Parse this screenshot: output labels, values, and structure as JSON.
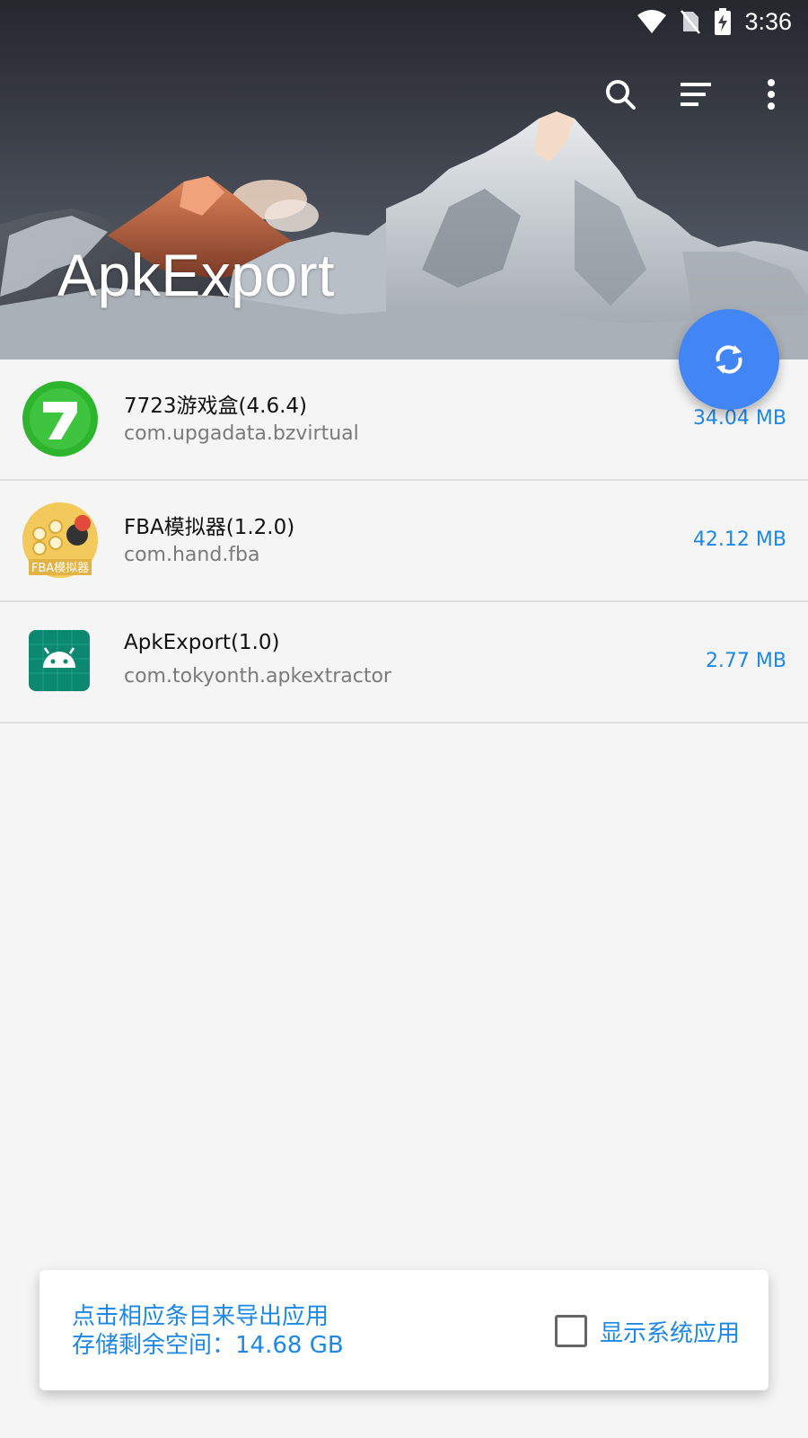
{
  "status_bar": {
    "time": "3:36",
    "icons": [
      "wifi-icon",
      "no-sim-icon",
      "battery-charging-icon"
    ]
  },
  "toolbar": {
    "actions": [
      "search-icon",
      "sort-icon",
      "more-vert-icon"
    ]
  },
  "header": {
    "title": "ApkExport"
  },
  "fab": {
    "icon": "refresh-icon",
    "color": "#4285f4"
  },
  "apps": [
    {
      "name": "7723游戏盒(4.6.4)",
      "package": "com.upgadata.bzvirtual",
      "size": "34.04 MB",
      "icon": "app-7723-icon"
    },
    {
      "name": "FBA模拟器(1.2.0)",
      "package": "com.hand.fba",
      "size": "42.12 MB",
      "icon": "app-fba-icon",
      "icon_text": "FBA模拟器"
    },
    {
      "name": "ApkExport(1.0)",
      "package": "com.tokyonth.apkextractor",
      "size": "2.77 MB",
      "icon": "android-icon"
    }
  ],
  "footer": {
    "hint_line1": "点击相应条目来导出应用",
    "hint_line2": "存储剩余空间：14.68 GB",
    "show_system_label": "显示系统应用",
    "show_system_checked": false
  },
  "colors": {
    "accent": "#1e88e5",
    "fab": "#4285f4",
    "background": "#f5f5f5"
  }
}
